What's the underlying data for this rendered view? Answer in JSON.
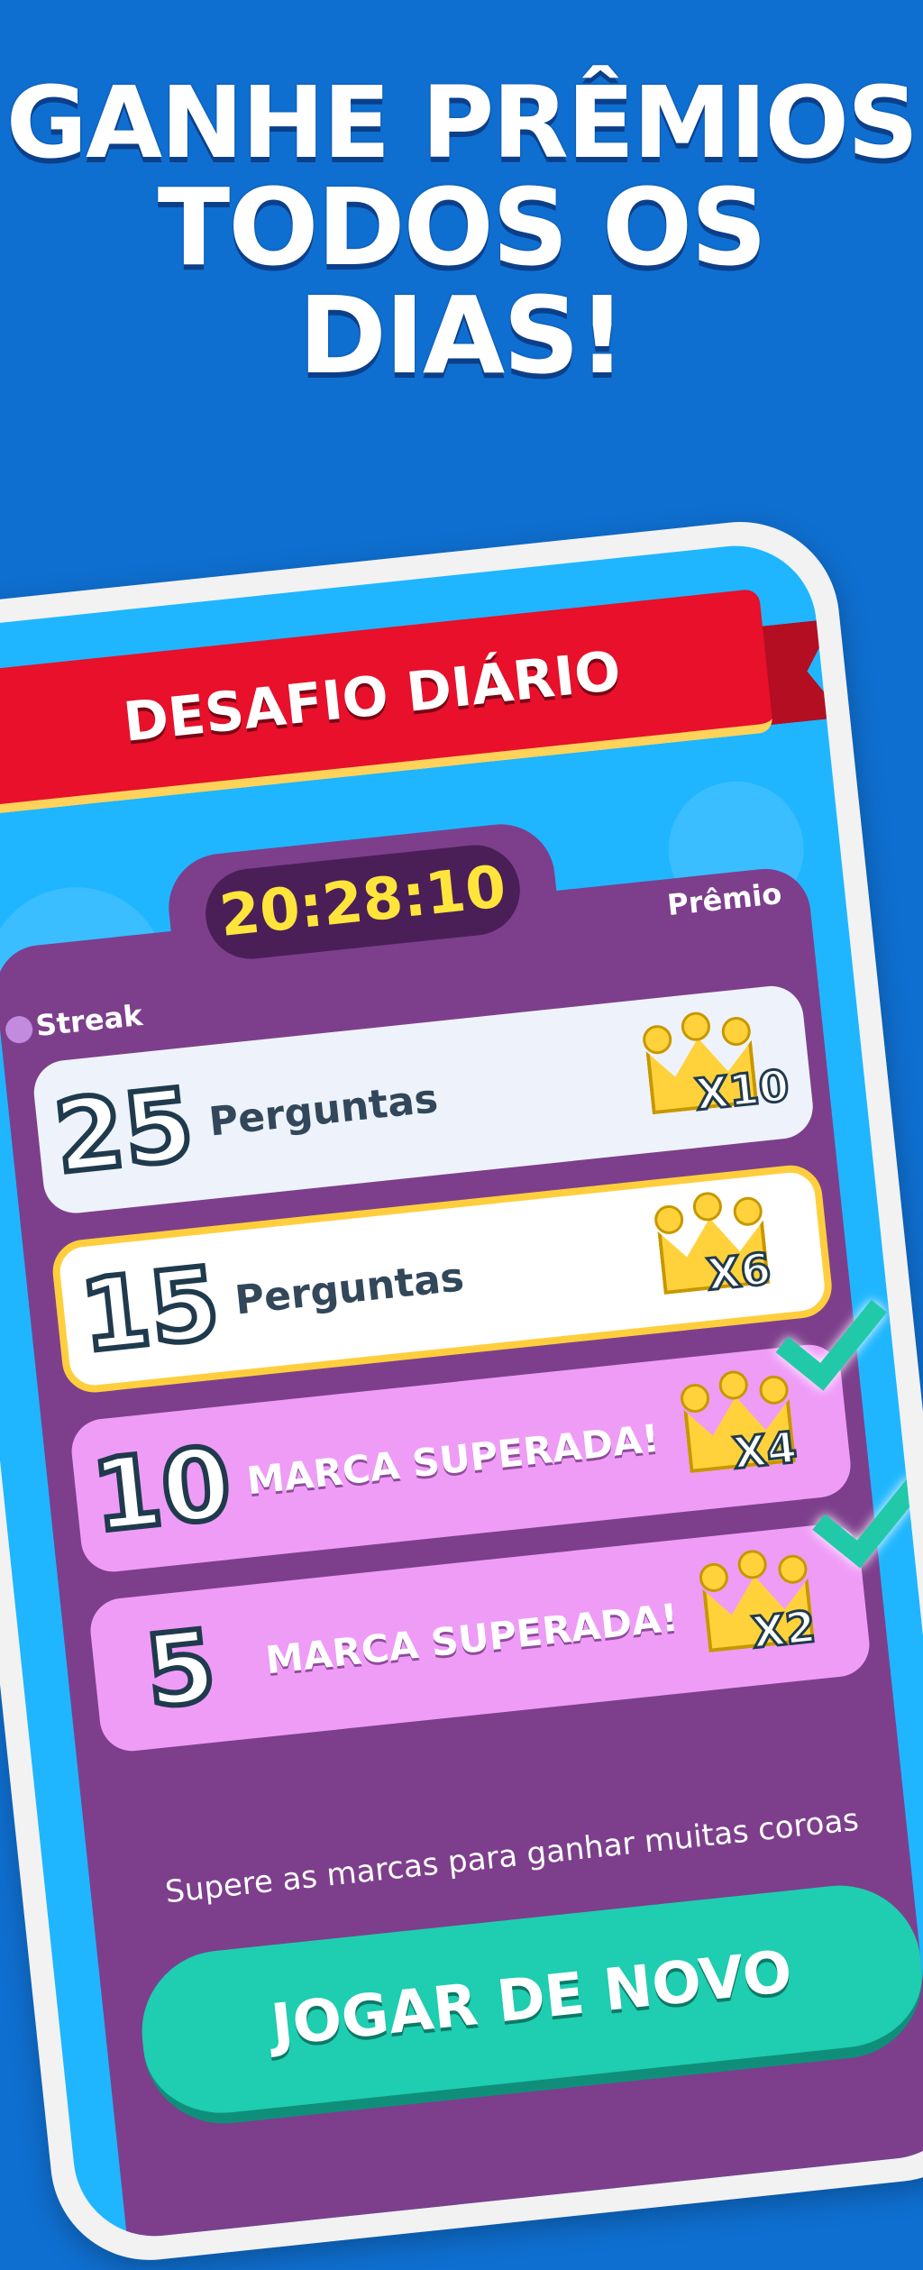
{
  "headline": {
    "line1": "GANHE PRÊMIOS",
    "line2": "TODOS OS DIAS!"
  },
  "screen": {
    "banner_title": "DESAFIO DIÁRIO",
    "timer": "20:28:10",
    "col_streak": "Streak",
    "col_premio": "Prêmio",
    "rows": [
      {
        "number": "25",
        "label": "Perguntas",
        "multiplier": "X10",
        "state": "locked"
      },
      {
        "number": "15",
        "label": "Perguntas",
        "multiplier": "X6",
        "state": "current"
      },
      {
        "number": "10",
        "label": "MARCA SUPERADA!",
        "multiplier": "X4",
        "state": "completed"
      },
      {
        "number": "5",
        "label": "MARCA SUPERADA!",
        "multiplier": "X2",
        "state": "completed"
      }
    ],
    "hint": "Supere as marcas para ganhar muitas coroas",
    "cta": "JOGAR DE NOVO"
  },
  "colors": {
    "background": "#0f6fd0",
    "banner": "#e8102b",
    "panel": "#7d3f8c",
    "timer_text": "#ffe53b",
    "completed_row": "#ef9cf7",
    "cta": "#1fcdb0",
    "check": "#22c9a9"
  },
  "icons": [
    "crown-icon",
    "check-icon"
  ]
}
